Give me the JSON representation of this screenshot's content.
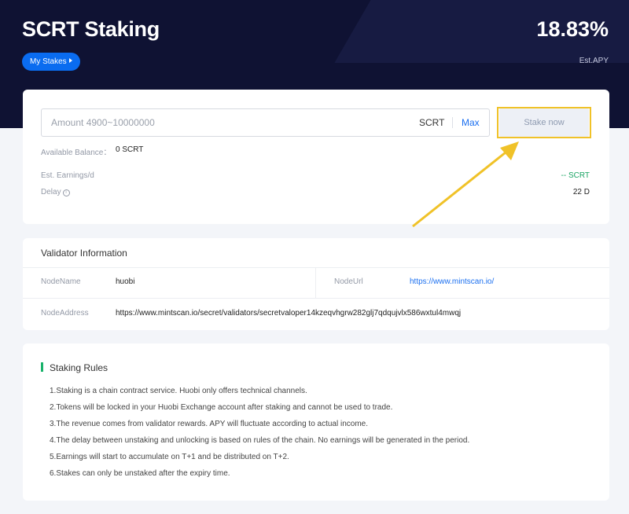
{
  "header": {
    "title": "SCRT Staking",
    "my_stakes_label": "My Stakes",
    "apy_value": "18.83%",
    "apy_label": "Est.APY"
  },
  "stake_form": {
    "amount_placeholder": "Amount 4900~10000000",
    "amount_value": "",
    "unit": "SCRT",
    "max_label": "Max",
    "stake_button_label": "Stake now",
    "available_balance_label": "Available Balance：",
    "available_balance_value": "0 SCRT",
    "est_earnings_label": "Est. Earnings/d",
    "est_earnings_value": "-- SCRT",
    "delay_label": "Delay",
    "delay_value": "22 D"
  },
  "validator": {
    "section_title": "Validator Information",
    "node_name_label": "NodeName",
    "node_name_value": "huobi",
    "node_url_label": "NodeUrl",
    "node_url_value": "https://www.mintscan.io/",
    "node_address_label": "NodeAddress",
    "node_address_value": "https://www.mintscan.io/secret/validators/secretvaloper14kzeqvhgrw282glj7qdqujvlx586wxtul4mwqj"
  },
  "rules": {
    "section_title": "Staking Rules",
    "items": [
      "1.Staking is a chain contract service. Huobi only offers technical channels.",
      "2.Tokens will be locked in your Huobi Exchange account after staking and cannot be used to trade.",
      "3.The revenue comes from validator rewards. APY will fluctuate according to actual income.",
      "4.The delay between unstaking and unlocking is based on rules of the chain. No earnings will be generated in the period.",
      "5.Earnings will start to accumulate on T+1 and be distributed on T+2.",
      "6.Stakes can only be unstaked after the expiry time."
    ]
  },
  "icons": {
    "info": "info-circle-icon",
    "play": "play-triangle-icon"
  },
  "colors": {
    "header_bg": "#0f1233",
    "accent_blue": "#1a6ff0",
    "highlight_yellow": "#f0c228",
    "positive_green": "#19a463"
  }
}
